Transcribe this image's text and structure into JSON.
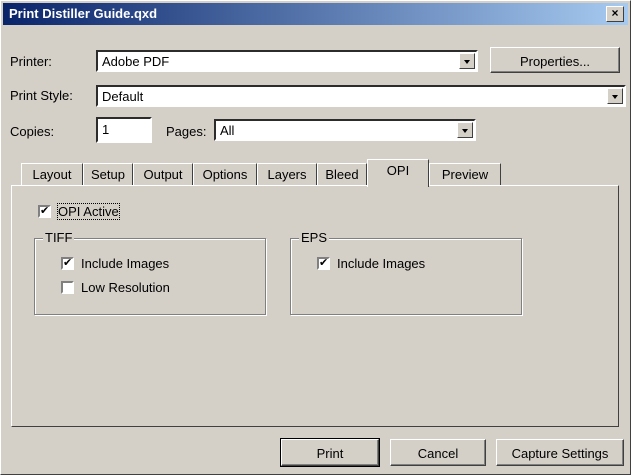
{
  "window": {
    "title": "Print Distiller Guide.qxd",
    "close_label": "×"
  },
  "printer": {
    "label": "Printer:",
    "value": "Adobe PDF",
    "properties_label": "Properties..."
  },
  "print_style": {
    "label": "Print Style:",
    "value": "Default"
  },
  "copies": {
    "label": "Copies:",
    "value": "1"
  },
  "pages": {
    "label": "Pages:",
    "value": "All"
  },
  "tabs": [
    "Layout",
    "Setup",
    "Output",
    "Options",
    "Layers",
    "Bleed",
    "OPI",
    "Preview"
  ],
  "active_tab": "OPI",
  "opi": {
    "active_label": "OPI Active",
    "active_checked": true,
    "tiff": {
      "title": "TIFF",
      "include_images": "Include Images",
      "include_checked": true,
      "low_res": "Low Resolution",
      "low_res_checked": false
    },
    "eps": {
      "title": "EPS",
      "include_images": "Include Images",
      "include_checked": true
    }
  },
  "buttons": {
    "print": "Print",
    "cancel": "Cancel",
    "capture": "Capture Settings"
  }
}
